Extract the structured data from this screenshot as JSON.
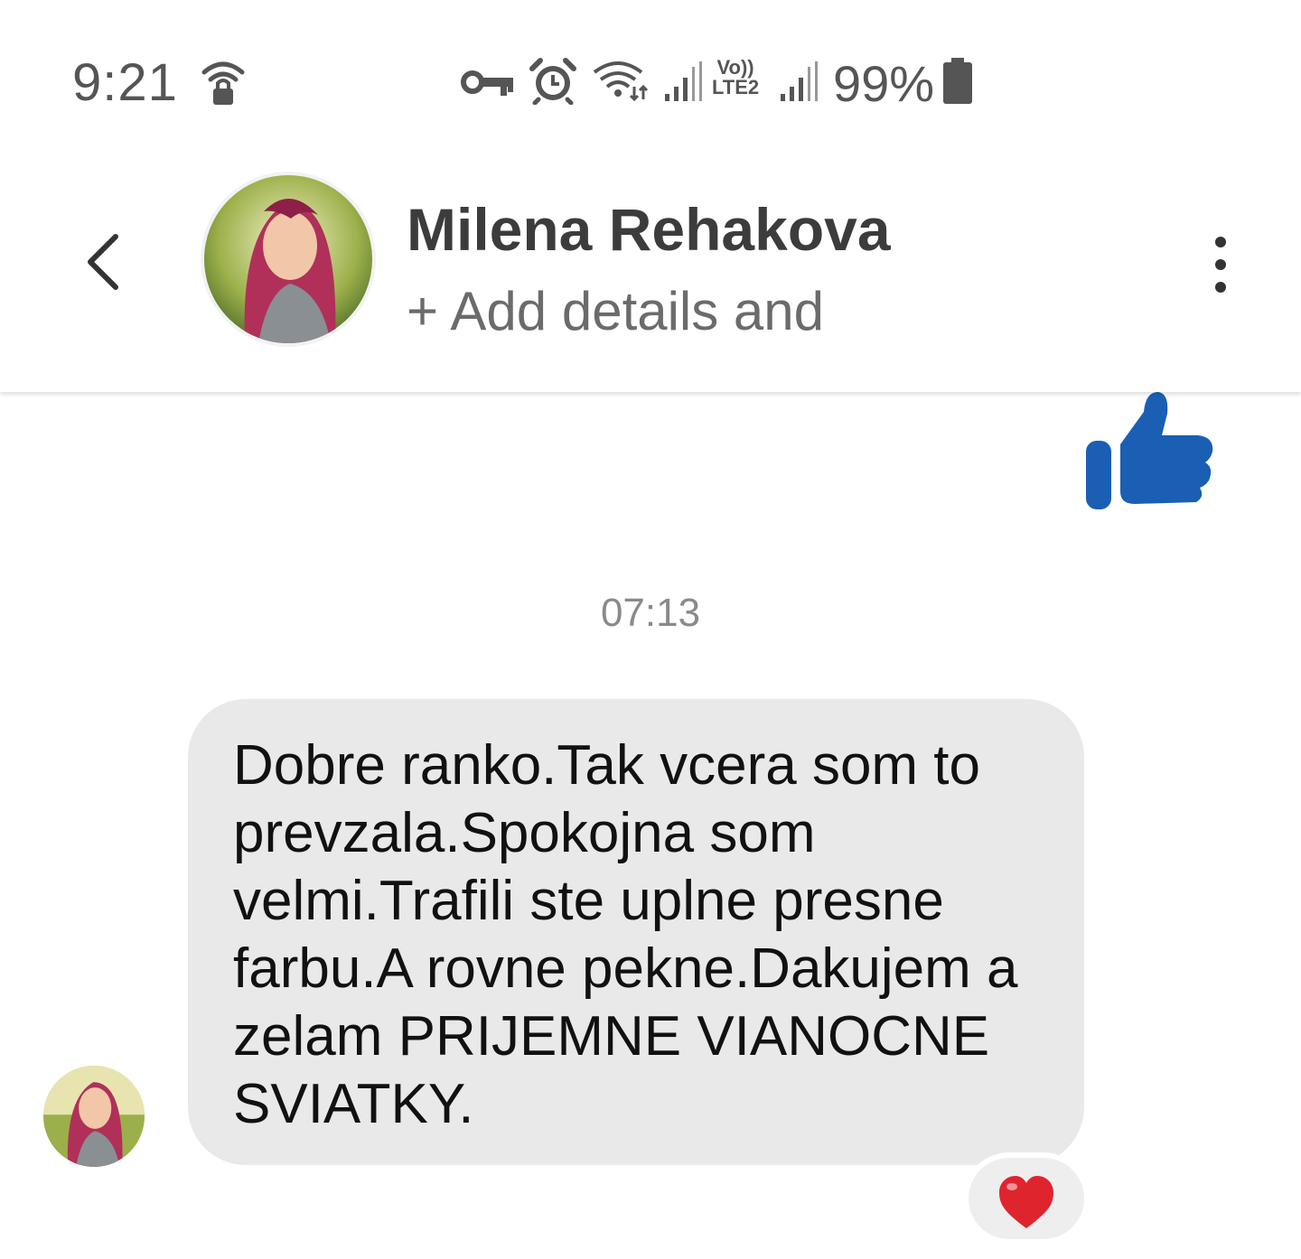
{
  "status_bar": {
    "time": "9:21",
    "network_label_top": "Vo))",
    "network_label_bottom": "LTE2",
    "battery_percent": "99%"
  },
  "header": {
    "contact_name": "Milena Rehakova",
    "subtitle": "+ Add details and"
  },
  "chat": {
    "timestamp": "07:13",
    "message": "Dobre ranko.Tak vcera som to prevzala.Spokojna som velmi.Trafili ste uplne presne farbu.A rovne pekne.Dakujem a zelam PRIJEMNE VIANOCNE SVIATKY.",
    "reaction": "❤️"
  },
  "colors": {
    "like_blue": "#1a5fb4",
    "bubble_gray": "#e9e9e9",
    "heart_red": "#e0242e"
  },
  "icons": [
    "back-icon",
    "more-vert-icon",
    "thumbs-up-icon",
    "heart-icon",
    "vpn-key-icon",
    "alarm-icon",
    "wifi-icon",
    "signal-icon",
    "battery-icon",
    "wifi-lock-icon"
  ]
}
